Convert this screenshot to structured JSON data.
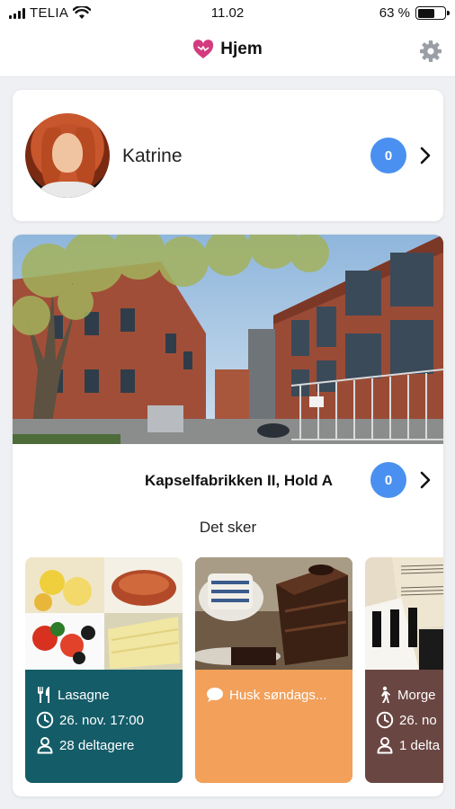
{
  "status_bar": {
    "carrier": "TELIA",
    "time": "11.02",
    "battery_text": "63 %",
    "battery_level_percent": 63
  },
  "nav": {
    "title": "Hjem",
    "logo_icon": "heart-icon",
    "settings_icon": "gear-icon"
  },
  "profile": {
    "name": "Katrine",
    "badge_count": "0"
  },
  "group": {
    "name": "Kapselfabrikken II, Hold A",
    "badge_count": "0",
    "section_title": "Det sker"
  },
  "events": [
    {
      "color": "#145c68",
      "title_icon": "cutlery-icon",
      "title": "Lasagne",
      "time": "26. nov. 17:00",
      "participants": "28 deltagere"
    },
    {
      "color": "#f2a05a",
      "title_icon": "chat-icon",
      "title": "Husk søndags..."
    },
    {
      "color": "#6a4642",
      "title_icon": "walking-icon",
      "title": "Morge",
      "time": "26. no",
      "participants": "1 delta"
    }
  ],
  "colors": {
    "accent_badge": "#4a90f0",
    "background": "#eef0f3"
  }
}
